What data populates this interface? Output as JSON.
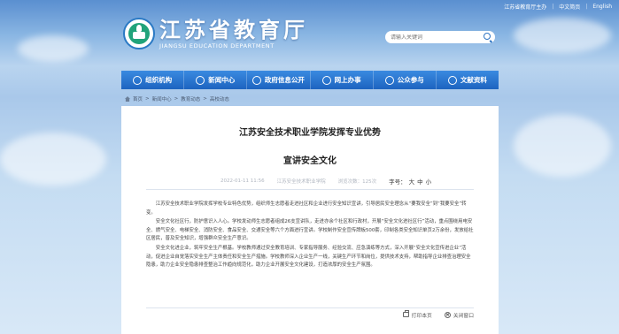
{
  "topbar": {
    "site_link": "江苏省教育厅主办",
    "chinese_link": "中文简页",
    "english_link": "English"
  },
  "logo": {
    "cn": "江苏省教育厅",
    "en": "JIANGSU EDUCATION DEPARTMENT"
  },
  "search": {
    "placeholder": "请输入关键词"
  },
  "nav": {
    "items": [
      {
        "label": "组织机构",
        "icon": "org-icon"
      },
      {
        "label": "新闻中心",
        "icon": "news-icon"
      },
      {
        "label": "政府信息公开",
        "icon": "info-icon"
      },
      {
        "label": "网上办事",
        "icon": "service-icon"
      },
      {
        "label": "公众参与",
        "icon": "public-icon"
      },
      {
        "label": "文献资料",
        "icon": "docs-icon"
      }
    ]
  },
  "breadcrumb": {
    "items": [
      "首页",
      "新闻中心",
      "教育动态",
      "高校动态"
    ]
  },
  "article": {
    "title_line1": "江苏安全技术职业学院发挥专业优势",
    "title_line2": "宣讲安全文化",
    "date": "2022-01-11 11:56",
    "source": "江苏安全技术职业学院",
    "views": "浏览次数：125次",
    "font_size_label": "字号：",
    "size_large": "大",
    "size_medium": "中",
    "size_small": "小",
    "paragraphs": [
      "江苏安全技术职业学院发挥学校专业特色优势，组织师生志愿者走进社区和企业进行安全知识宣讲，引导居民安全理念从“要我安全”到“我要安全”转变。",
      "安全文化社区行，防护意识入人心。学校发动师生志愿者组成26支宣讲队，走进亦余个社区和行政村，开展“安全文化进社区行”活动，重点围绕用电安全、燃气安全、电梯安全、消防安全、食品安全、交通安全等六个方面进行宣讲。学校制作安全宣传牌板500套，印制各类安全知识单页2万余份，发放给社区居民，普及安全知识，增强群众安全生产意识。",
      "安全文化进企业，筑牢安全生产根基。学校教师通过安全教育培训、专家指导服务、经验交流、应急演练等方式，深入开展“安全文化宣传进企业”活动，促进企业自觉落实安全生产主体责任和安全生产措施。学校教师深入企业生产一线，关键生产环节和岗位，提供技术支持，帮助指导企业排查治理安全隐患，助力企业安全隐患排查整治工作趋向规范化，助力企业开展安全文化建设，打造浓厚的安全生产氛围。"
    ]
  },
  "footer": {
    "print_label": "打印本页",
    "close_label": "关闭窗口"
  }
}
